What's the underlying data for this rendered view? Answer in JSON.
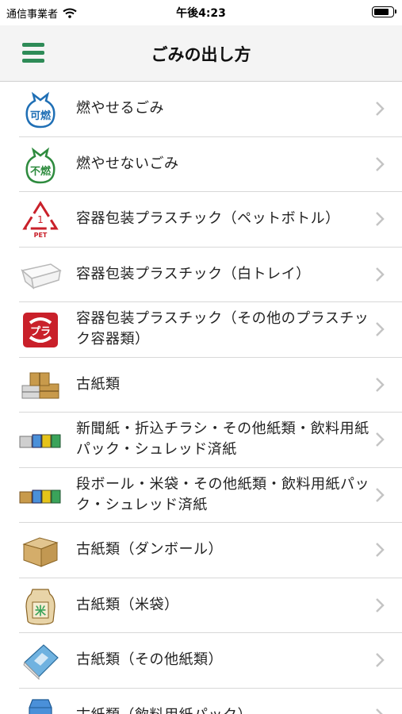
{
  "status": {
    "carrier": "通信事業者",
    "time": "午後4:23"
  },
  "nav": {
    "title": "ごみの出し方",
    "menu_icon": "hamburger-menu-icon",
    "accent_color": "#2e8b57"
  },
  "items": [
    {
      "label": "燃やせるごみ",
      "icon": "burnable-garbage-bag-icon",
      "badge": "可燃"
    },
    {
      "label": "燃やせないごみ",
      "icon": "non-burnable-garbage-bag-icon",
      "badge": "不燃"
    },
    {
      "label": "容器包装プラスチック（ペットボトル）",
      "icon": "pet-recycle-icon",
      "badge": "PET"
    },
    {
      "label": "容器包装プラスチック（白トレイ）",
      "icon": "white-tray-icon"
    },
    {
      "label": "容器包装プラスチック（その他のプラスチック容器類）",
      "icon": "plastic-mark-icon",
      "badge": "プラ"
    },
    {
      "label": "古紙類",
      "icon": "waste-paper-bundles-icon"
    },
    {
      "label": "新聞紙・折込チラシ・その他紙類・飲料用紙パック・シュレッド済紙",
      "icon": "newspaper-cartons-icon"
    },
    {
      "label": "段ボール・米袋・その他紙類・飲料用紙パック・シュレッド済紙",
      "icon": "cardboard-cartons-icon"
    },
    {
      "label": "古紙類（ダンボール）",
      "icon": "cardboard-box-icon"
    },
    {
      "label": "古紙類（米袋）",
      "icon": "rice-bag-icon",
      "badge": "米"
    },
    {
      "label": "古紙類（その他紙類）",
      "icon": "paper-book-icon"
    },
    {
      "label": "古紙類（飲料用紙パック）",
      "icon": "milk-carton-icon"
    }
  ]
}
